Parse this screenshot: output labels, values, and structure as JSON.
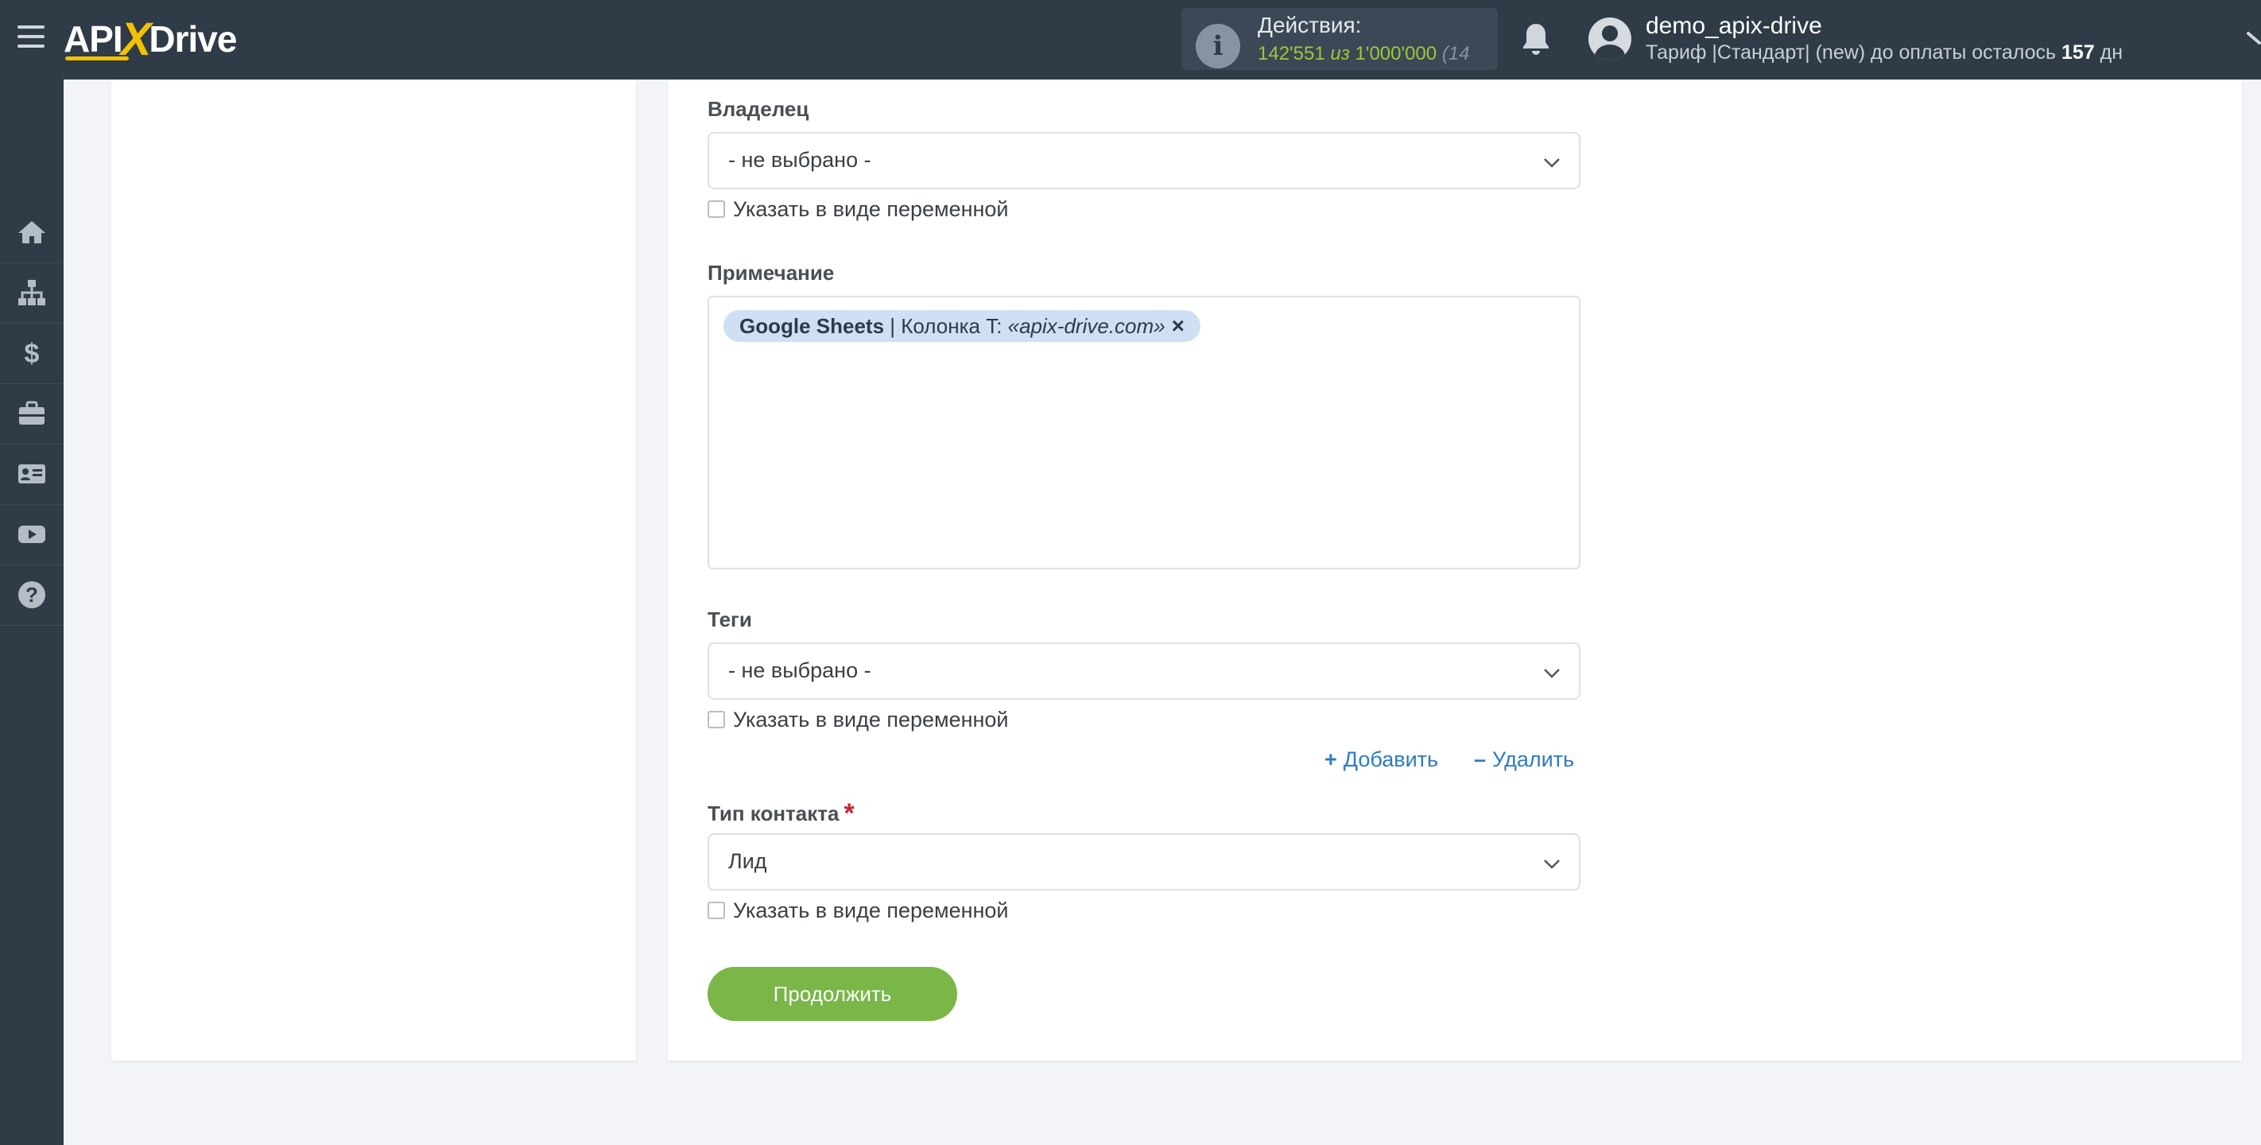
{
  "header": {
    "logo": {
      "left": "API",
      "x": "X",
      "right": "Drive"
    },
    "actions": {
      "label": "Действия:",
      "used": "142'551",
      "of_label": "из",
      "limit": "1'000'000",
      "tail": "(14"
    },
    "user": {
      "name": "demo_apix-drive",
      "tariff_prefix": "Тариф |Стандарт| (new) до оплаты осталось",
      "days": "157",
      "days_unit": "дн"
    }
  },
  "sidebar": {
    "items": [
      {
        "icon": "home-icon"
      },
      {
        "icon": "sitemap-icon"
      },
      {
        "icon": "dollar-icon"
      },
      {
        "icon": "briefcase-icon"
      },
      {
        "icon": "id-card-icon"
      },
      {
        "icon": "youtube-icon"
      },
      {
        "icon": "help-icon"
      }
    ]
  },
  "form": {
    "owner": {
      "label": "Владелец",
      "value": "- не выбрано -",
      "var_label": "Указать в виде переменной"
    },
    "note": {
      "label": "Примечание",
      "chip": {
        "source": "Google Sheets",
        "separator": " | Колонка T: ",
        "value": "«apix-drive.com»",
        "remove": "×"
      }
    },
    "tags": {
      "label": "Теги",
      "value": "- не выбрано -",
      "var_label": "Указать в виде переменной"
    },
    "add_label": "Добавить",
    "delete_label": "Удалить",
    "contact_type": {
      "label": "Тип контакта",
      "required_mark": "*",
      "value": "Лид",
      "var_label": "Указать в виде переменной"
    },
    "continue_label": "Продолжить"
  },
  "colors": {
    "topbar": "#2f3b47",
    "accent_green": "#7ab648",
    "link_blue": "#2e7bbf",
    "chip_bg": "#cfe0f4"
  }
}
